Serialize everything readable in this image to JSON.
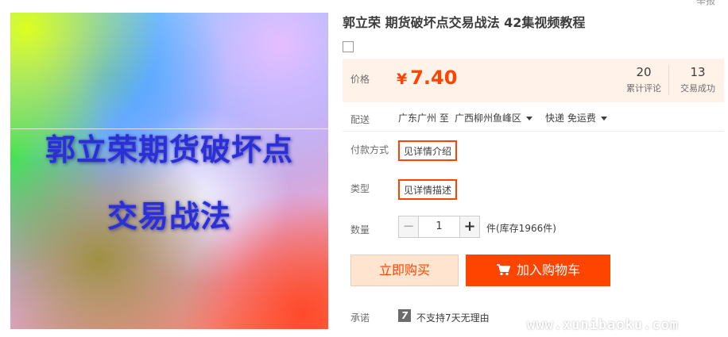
{
  "product": {
    "image_caption_line1": "郭立荣期货破坏点",
    "image_caption_line2": "交易战法",
    "title": "郭立荣 期货破坏点交易战法 42集视频教程"
  },
  "header": {
    "top_right_text": "举报"
  },
  "price": {
    "label": "价格",
    "currency": "¥",
    "value": "7.40",
    "reviews_count": "20",
    "reviews_label": "累计评论",
    "deals_count": "13",
    "deals_label": "交易成功"
  },
  "shipping": {
    "label": "配送",
    "from": "广东广州 至",
    "to": "广西柳州鱼峰区",
    "method": "快递 免运费"
  },
  "payment": {
    "label": "付款方式",
    "option": "见详情介绍"
  },
  "type": {
    "label": "类型",
    "option": "见详情描述"
  },
  "quantity": {
    "label": "数量",
    "minus": "−",
    "value": "1",
    "plus": "+",
    "stock_text": "件(库存1966件)"
  },
  "actions": {
    "buy_now": "立即购买",
    "add_to_cart": "加入购物车"
  },
  "promise": {
    "label": "承诺",
    "icon_text": "7",
    "text": "不支持7天无理由"
  },
  "watermark": "www.xunibaoku.com",
  "colors": {
    "accent": "#ff4400",
    "price_bg": "#fff2e8"
  }
}
